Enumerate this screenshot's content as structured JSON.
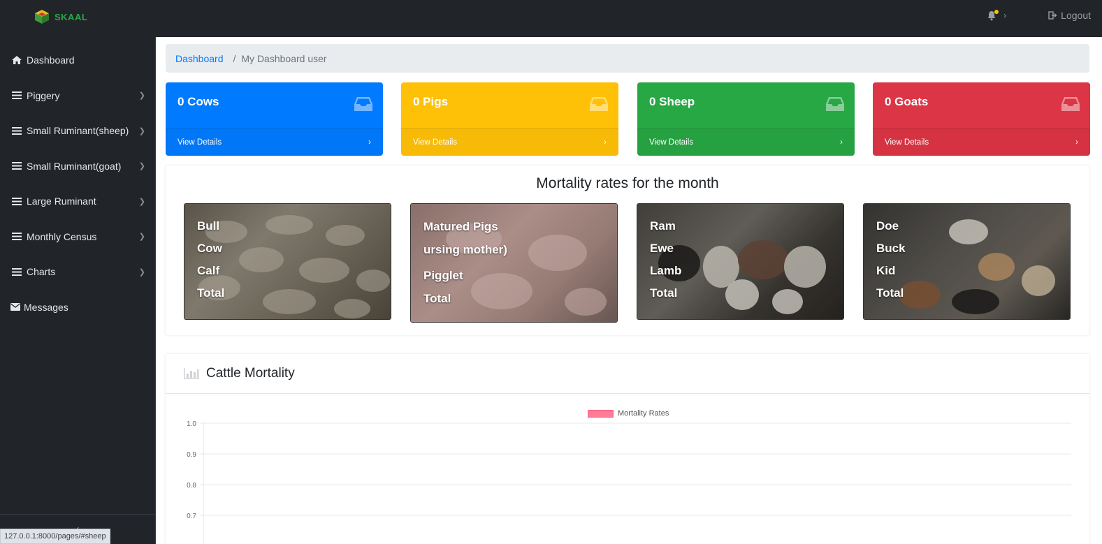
{
  "brand": {
    "name": "SKAAL"
  },
  "topbar": {
    "logout_label": "Logout"
  },
  "sidebar": {
    "items": [
      {
        "label": "Dashboard",
        "icon": "home-icon",
        "chevron": false
      },
      {
        "label": "Piggery",
        "icon": "list-icon",
        "chevron": true
      },
      {
        "label": "Small Ruminant(sheep)",
        "icon": "list-icon",
        "chevron": true
      },
      {
        "label": "Small Ruminant(goat)",
        "icon": "list-icon",
        "chevron": true
      },
      {
        "label": "Large Ruminant",
        "icon": "list-icon",
        "chevron": true
      },
      {
        "label": "Monthly Census",
        "icon": "list-icon",
        "chevron": true
      },
      {
        "label": "Charts",
        "icon": "list-icon",
        "chevron": true
      },
      {
        "label": "Messages",
        "icon": "envelope-icon",
        "chevron": false
      }
    ]
  },
  "status_url": "127.0.0.1:8000/pages/#sheep",
  "breadcrumb": {
    "link": "Dashboard",
    "separator": "/",
    "current": "My Dashboard user"
  },
  "cards": [
    {
      "title": "0 Cows",
      "footer": "View Details",
      "color": "#007bff"
    },
    {
      "title": "0 Pigs",
      "footer": "View Details",
      "color": "#ffc107"
    },
    {
      "title": "0 Sheep",
      "footer": "View Details",
      "color": "#28a745"
    },
    {
      "title": "0 Goats",
      "footer": "View Details",
      "color": "#dc3545"
    }
  ],
  "mortality": {
    "title": "Mortality rates for the month",
    "photos": [
      {
        "lines": [
          "Bull",
          "Cow",
          "Calf",
          "Total"
        ]
      },
      {
        "lines": [
          "Matured Pigs",
          "ursing mother)",
          "Pigglet",
          "Total"
        ]
      },
      {
        "lines": [
          "Ram",
          "Ewe",
          "Lamb",
          "Total"
        ]
      },
      {
        "lines": [
          "Doe",
          "Buck",
          "Kid",
          "Total"
        ]
      }
    ]
  },
  "chart_panel": {
    "title": "Cattle Mortality",
    "icon": "bar-chart-icon"
  },
  "chart_data": {
    "type": "bar",
    "title": "",
    "series": [
      {
        "name": "Mortality Rates",
        "values": []
      }
    ],
    "categories": [],
    "y_ticks": [
      "1.0",
      "0.9",
      "0.8",
      "0.7"
    ],
    "ylim": [
      0.7,
      1.0
    ],
    "legend": "top-center",
    "grid": true,
    "colors": {
      "series": "#ff6384"
    }
  }
}
